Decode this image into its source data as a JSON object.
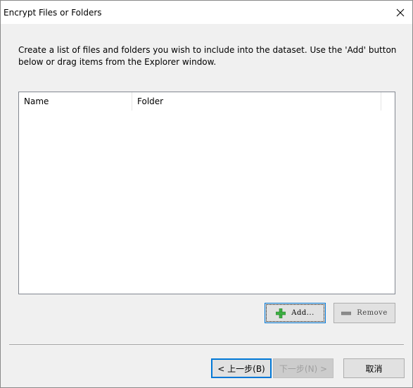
{
  "window": {
    "title": "Encrypt Files or Folders"
  },
  "instructions": "Create a list of files and folders you wish to include into the dataset. Use the 'Add' button below or drag items from the Explorer window.",
  "list": {
    "columns": [
      "Name",
      "Folder"
    ]
  },
  "buttons": {
    "add": "Add...",
    "remove": "Remove",
    "back": "< 上一步(B)",
    "next": "下一步(N) >",
    "cancel": "取消"
  },
  "colors": {
    "accent": "#0078d7",
    "add_icon": "#3cb043"
  },
  "icons": {
    "close": "close-icon",
    "add": "plus-icon",
    "remove": "minus-icon"
  }
}
